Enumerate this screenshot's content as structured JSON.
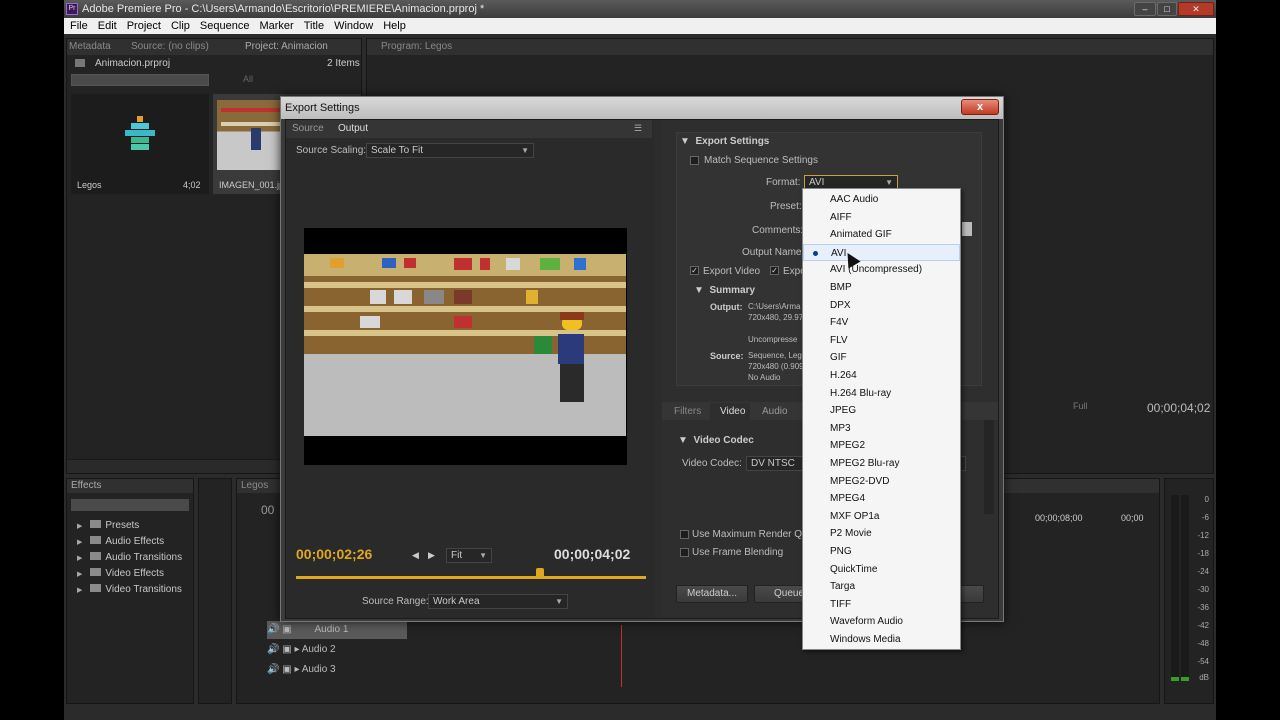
{
  "app": {
    "title": "Adobe Premiere Pro - C:\\Users\\Armando\\Escritorio\\PREMIERE\\Animacion.prproj *",
    "logo_text": "Pr",
    "window_buttons": [
      "–",
      "□",
      "✕"
    ]
  },
  "menubar": [
    "File",
    "Edit",
    "Project",
    "Clip",
    "Sequence",
    "Marker",
    "Title",
    "Window",
    "Help"
  ],
  "project_panel": {
    "tabs": [
      "Metadata",
      "Source: (no clips)",
      "Project: Animacion"
    ],
    "file_name": "Animacion.prproj",
    "item_count": "2 Items",
    "in_label": "All",
    "items": [
      {
        "name": "Legos",
        "duration": "4;02"
      },
      {
        "name": "IMAGEN_001.jpg",
        "duration": ""
      }
    ]
  },
  "program_monitor": {
    "tab": "Program: Legos",
    "timecode": "00;00;04;02",
    "zoom": "Full"
  },
  "effects_panel": {
    "tab": "Effects",
    "items": [
      "Presets",
      "Audio Effects",
      "Audio Transitions",
      "Video Effects",
      "Video Transitions"
    ]
  },
  "timeline": {
    "tab": "Legos",
    "timecode_left": "00",
    "ruler": [
      "00;00;08;00",
      "00;00"
    ],
    "tracks": [
      "Audio 1",
      "Audio 2",
      "Audio 3"
    ]
  },
  "audio_meter": {
    "labels": [
      "0",
      "-6",
      "-12",
      "-18",
      "-24",
      "-30",
      "-36",
      "-42",
      "-48",
      "-54",
      "dB"
    ]
  },
  "export_dialog": {
    "title": "Export Settings",
    "close_label": "x",
    "left_tabs": [
      "Source",
      "Output"
    ],
    "source_scaling_label": "Source Scaling:",
    "source_scaling_value": "Scale To Fit",
    "current_timecode": "00;00;02;26",
    "end_timecode": "00;00;04;02",
    "fit_value": "Fit",
    "source_range_label": "Source Range:",
    "source_range_value": "Work Area",
    "export_settings_header": "Export Settings",
    "match_sequence": "Match Sequence Settings",
    "format_label": "Format:",
    "format_value": "AVI",
    "preset_label": "Preset:",
    "comments_label": "Comments:",
    "output_name_label": "Output Name:",
    "export_video": "Export Video",
    "export_audio": "Expor",
    "summary_header": "Summary",
    "summary": {
      "output_label": "Output:",
      "output_lines": [
        "C:\\Users\\Arma",
        "720x480, 29.97"
      ],
      "uncompressed": "Uncompresse",
      "source_label": "Source:",
      "source_lines": [
        "Sequence, Leg",
        "720x480 (0.909",
        "No Audio"
      ]
    },
    "bottom_tabs": [
      "Filters",
      "Video",
      "Audio"
    ],
    "video_codec_header": "Video Codec",
    "video_codec_label": "Video Codec:",
    "video_codec_value": "DV NTSC",
    "max_render": "Use Maximum Render Qualit",
    "frame_blending": "Use Frame Blending",
    "metadata_button": "Metadata...",
    "queue_button": "Queue"
  },
  "format_menu": {
    "selected": "AVI",
    "options": [
      "AAC Audio",
      "AIFF",
      "Animated GIF",
      "AVI",
      "AVI (Uncompressed)",
      "BMP",
      "DPX",
      "F4V",
      "FLV",
      "GIF",
      "H.264",
      "H.264 Blu-ray",
      "JPEG",
      "MP3",
      "MPEG2",
      "MPEG2 Blu-ray",
      "MPEG2-DVD",
      "MPEG4",
      "MXF OP1a",
      "P2 Movie",
      "PNG",
      "QuickTime",
      "Targa",
      "TIFF",
      "Waveform Audio",
      "Windows Media"
    ]
  },
  "colors": {
    "accent_timecode": "#e0a820",
    "menu_selected_bg": "#e6effa"
  }
}
